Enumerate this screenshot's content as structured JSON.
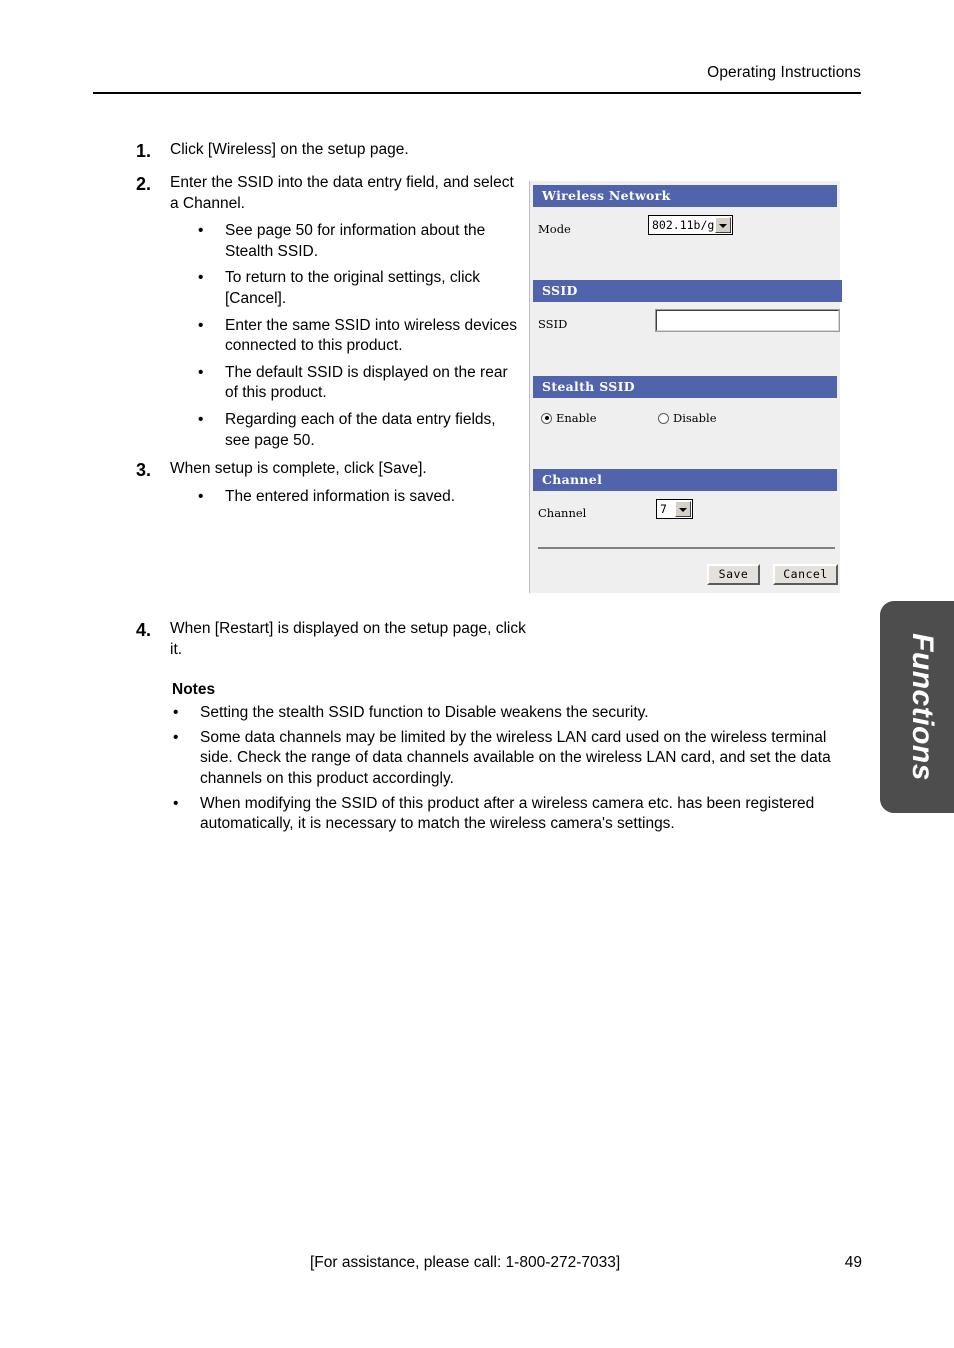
{
  "header": {
    "running_title": "Operating Instructions"
  },
  "steps": [
    {
      "number": "1.",
      "text": "Click [Wireless] on the setup page.",
      "bullets": []
    },
    {
      "number": "2.",
      "text": "Enter the SSID into the data entry field, and select a Channel.",
      "bullets": [
        "See page 50 for information about the Stealth SSID.",
        "To return to the original settings, click [Cancel].",
        "Enter the same SSID into wireless devices connected to this product.",
        "The default SSID is displayed on the rear of this product.",
        "Regarding each of the data entry fields, see page 50."
      ]
    },
    {
      "number": "3.",
      "text": "When setup is complete, click [Save].",
      "bullets": [
        "The entered information is saved."
      ]
    },
    {
      "number": "4.",
      "text": "When [Restart] is displayed on the setup page, click it.",
      "bullets": []
    }
  ],
  "screenshot_panel": {
    "sections": {
      "wireless_network": {
        "title": "Wireless Network",
        "mode_label": "Mode",
        "mode_value": "802.11b/g"
      },
      "ssid": {
        "title": "SSID",
        "ssid_label": "SSID",
        "ssid_value": "",
        "ssid_placeholder": ""
      },
      "stealth_ssid": {
        "title": "Stealth SSID",
        "enable_label": "Enable",
        "disable_label": "Disable",
        "selected": "Enable"
      },
      "channel": {
        "title": "Channel",
        "channel_label": "Channel",
        "channel_value": "7"
      }
    },
    "buttons": {
      "save": "Save",
      "cancel": "Cancel"
    },
    "colors": {
      "section_header_blue": "#5063ab",
      "panel_background": "#efefef"
    }
  },
  "notes": {
    "title": "Notes",
    "items": [
      "Setting the stealth SSID function to Disable weakens the security.",
      "Some data channels may be limited by the wireless LAN card used on the wireless terminal side. Check the range of data channels available on the wireless LAN card, and set the data channels on this product accordingly.",
      "When modifying the SSID of this product after a wireless camera etc. has been registered automatically, it is necessary to match the wireless camera's settings."
    ]
  },
  "side_tab": {
    "label": "Functions",
    "color": "#4d4d4d"
  },
  "footer": {
    "assistance": "[For assistance, please call: 1-800-272-7033]",
    "page_number": "49"
  },
  "bullet_glyph": "•"
}
